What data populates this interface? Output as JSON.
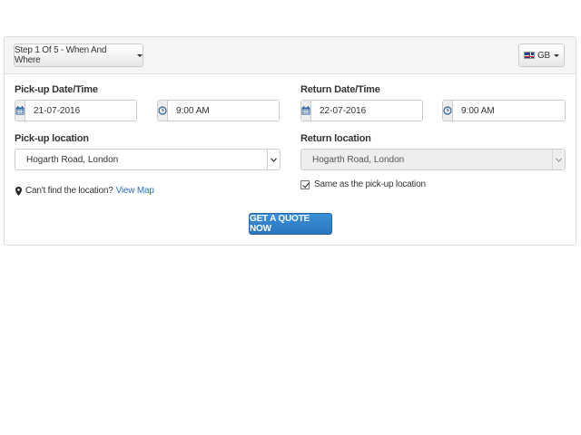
{
  "header": {
    "step_label": "Step 1 Of 5 - When And Where",
    "lang_label": "GB"
  },
  "pickup": {
    "datetime_label": "Pick-up Date/Time",
    "date_value": "21-07-2016",
    "time_value": "9:00 AM",
    "location_label": "Pick-up location",
    "location_value": "Hogarth Road, London",
    "cant_find_text": "Can't find the location?",
    "view_map_link": "View Map"
  },
  "return": {
    "datetime_label": "Return Date/Time",
    "date_value": "22-07-2016",
    "time_value": "9:00 AM",
    "location_label": "Return location",
    "location_value": "Hogarth Road, London",
    "same_as_pickup_label": "Same as the pick-up location",
    "same_as_pickup_checked": true
  },
  "submit_label": "GET A QUOTE NOW",
  "colors": {
    "primary": "#2a76c0",
    "link": "#2a6fb8",
    "icon_blue": "#2a5f9e"
  }
}
